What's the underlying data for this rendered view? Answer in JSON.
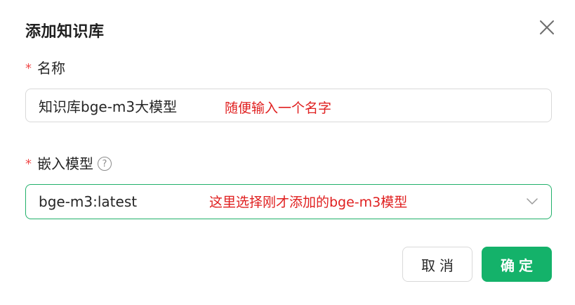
{
  "dialog": {
    "title": "添加知识库",
    "close_icon": "close-icon"
  },
  "name_field": {
    "required_mark": "*",
    "label": "名称",
    "value": "知识库bge-m3大模型",
    "annotation": "随便输入一个名字"
  },
  "embed_field": {
    "required_mark": "*",
    "label": "嵌入模型",
    "help_icon": "question-circle-icon",
    "help_glyph": "?",
    "selected_value": "bge-m3:latest",
    "annotation": "这里选择刚才添加的bge-m3模型",
    "chevron_icon": "chevron-down-icon"
  },
  "footer": {
    "cancel_label": "取消",
    "ok_label": "确定"
  },
  "colors": {
    "primary": "#14b26a",
    "annotation": "#e02020",
    "required": "#f04b4b"
  }
}
